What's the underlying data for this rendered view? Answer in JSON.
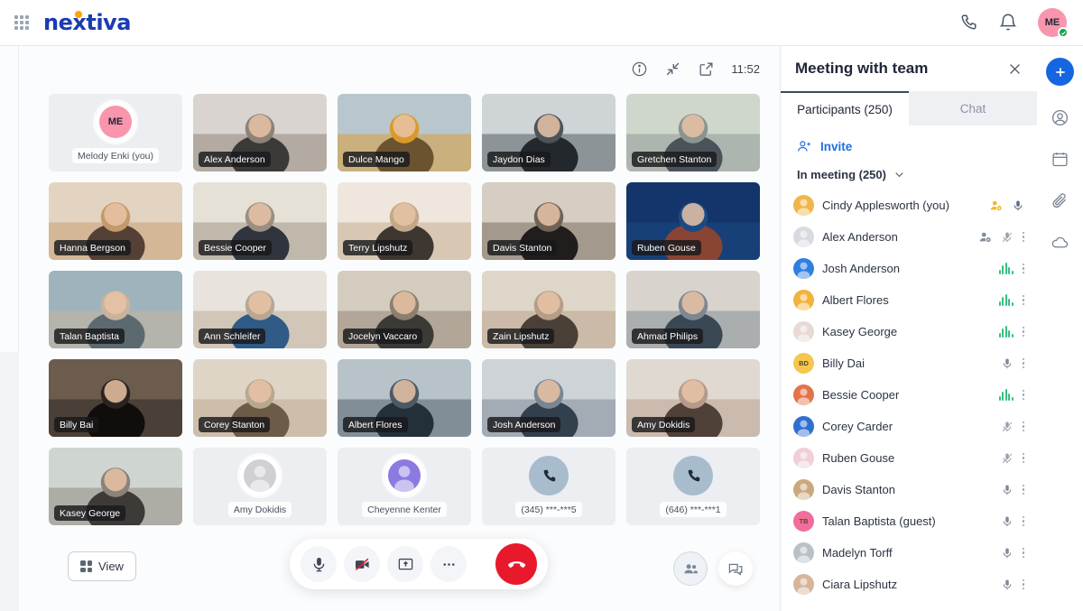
{
  "brand": {
    "name": "nextiva"
  },
  "topbar": {
    "phone_icon": "phone-icon",
    "bell_icon": "bell-icon",
    "avatar_initials": "ME"
  },
  "stage": {
    "time": "11:52",
    "info_icon": "info-icon",
    "collapse_icon": "collapse-icon",
    "popout_icon": "popout-icon",
    "view_button": "View",
    "controls": {
      "mic": "microphone",
      "camera": "camera-off",
      "share": "share-screen",
      "more": "more-options",
      "hangup": "end-call"
    },
    "right_controls": {
      "participants": "participants-toggle",
      "chat": "chat-toggle"
    }
  },
  "video_grid": {
    "rows": [
      [
        {
          "name": "Melody Enki (you)",
          "type": "self-novideo",
          "initials": "ME",
          "avatar_bg": "#f995ad"
        },
        {
          "name": "Alex Anderson",
          "type": "video",
          "c1": "#d9d4cf",
          "c2": "#8e8276",
          "c3": "#3c3a38"
        },
        {
          "name": "Dulce Mango",
          "type": "video",
          "c1": "#b9c6cd",
          "c2": "#d99a2b",
          "c3": "#6b5230"
        },
        {
          "name": "Jaydon Dias",
          "type": "video",
          "c1": "#cfd4d6",
          "c2": "#4c5359",
          "c3": "#23282c"
        },
        {
          "name": "Gretchen Stanton",
          "type": "video",
          "c1": "#cfd7cc",
          "c2": "#8a9490",
          "c3": "#4a5359"
        }
      ],
      [
        {
          "name": "Hanna Bergson",
          "type": "video",
          "c1": "#e3d4c2",
          "c2": "#c49a6c",
          "c3": "#554035"
        },
        {
          "name": "Bessie Cooper",
          "type": "video",
          "c1": "#e6e1d7",
          "c2": "#9a8f80",
          "c3": "#30343c"
        },
        {
          "name": "Terry Lipshutz",
          "type": "video",
          "c1": "#efe7dd",
          "c2": "#c2a789",
          "c3": "#3e3630"
        },
        {
          "name": "Davis Stanton",
          "type": "video",
          "c1": "#d6cec2",
          "c2": "#6f6356",
          "c3": "#201d1c"
        },
        {
          "name": "Ruben Gouse",
          "type": "video",
          "c1": "#13356b",
          "c2": "#1b4a86",
          "c3": "#8a4434"
        }
      ],
      [
        {
          "name": "Talan Baptista",
          "type": "video",
          "c1": "#9fb3bd",
          "c2": "#c9b39c",
          "c3": "#5c6a70"
        },
        {
          "name": "Ann Schleifer",
          "type": "video",
          "c1": "#e8e4dd",
          "c2": "#b9a794",
          "c3": "#2f5b86"
        },
        {
          "name": "Jocelyn Vaccaro",
          "type": "video",
          "c1": "#d5ccc0",
          "c2": "#8d7f6d",
          "c3": "#3b3a36"
        },
        {
          "name": "Zain Lipshutz",
          "type": "video",
          "c1": "#ded6c8",
          "c2": "#b59d86",
          "c3": "#4a4038"
        },
        {
          "name": "Ahmad Philips",
          "type": "video",
          "c1": "#d8d4cd",
          "c2": "#7e8892",
          "c3": "#3a4856"
        }
      ],
      [
        {
          "name": "Billy Bai",
          "type": "video",
          "c1": "#6c5c4e",
          "c2": "#2a2320",
          "c3": "#100d0c"
        },
        {
          "name": "Corey Stanton",
          "type": "video",
          "c1": "#ded5c7",
          "c2": "#b9a88f",
          "c3": "#6b5b47"
        },
        {
          "name": "Albert Flores",
          "type": "video",
          "c1": "#b8c3c9",
          "c2": "#4c5a66",
          "c3": "#23303a"
        },
        {
          "name": "Josh Anderson",
          "type": "video",
          "c1": "#cdd3d6",
          "c2": "#7a8693",
          "c3": "#32404e"
        },
        {
          "name": "Amy Dokidis",
          "type": "video",
          "c1": "#e0d9d1",
          "c2": "#b59b8c",
          "c3": "#4f4038"
        }
      ],
      [
        {
          "name": "Kasey George",
          "type": "video",
          "c1": "#cfd6d2",
          "c2": "#8c8277",
          "c3": "#3d3a37"
        },
        {
          "name": "Amy Dokidis",
          "type": "novideo",
          "avatar_bg": "#cfcfd4"
        },
        {
          "name": "Cheyenne Kenter",
          "type": "novideo",
          "avatar_bg": "#8d7ae0"
        },
        {
          "name": "(345) ***-***5",
          "type": "phone"
        },
        {
          "name": "(646) ***-***1",
          "type": "phone"
        }
      ]
    ]
  },
  "panel": {
    "title": "Meeting with team",
    "close_icon": "close-icon",
    "tabs": [
      {
        "label": "Participants (250)",
        "active": true
      },
      {
        "label": "Chat",
        "active": false
      }
    ],
    "invite_label": "Invite",
    "section_label": "In meeting (250)",
    "participants": [
      {
        "name": "Cindy Applesworth (you)",
        "avatar_bg": "#f0b64a",
        "initials": "",
        "photo": true,
        "icons": [
          "host",
          "mic-blue"
        ]
      },
      {
        "name": "Alex Anderson",
        "avatar_bg": "#d8dae0",
        "photo": true,
        "icons": [
          "cohost",
          "muted",
          "kebab"
        ]
      },
      {
        "name": "Josh Anderson",
        "avatar_bg": "#2f7fe0",
        "photo": true,
        "icons": [
          "wave",
          "kebab"
        ]
      },
      {
        "name": "Albert Flores",
        "avatar_bg": "#f2b33d",
        "photo": true,
        "icons": [
          "wave",
          "kebab"
        ]
      },
      {
        "name": "Kasey George",
        "avatar_bg": "#e7d9d3",
        "photo": true,
        "icons": [
          "wave",
          "kebab"
        ]
      },
      {
        "name": "Billy Dai",
        "avatar_bg": "#f6c64f",
        "initials": "BD",
        "photo": false,
        "icons": [
          "mic",
          "kebab"
        ]
      },
      {
        "name": "Bessie Cooper",
        "avatar_bg": "#e2734a",
        "photo": true,
        "icons": [
          "wave",
          "kebab"
        ]
      },
      {
        "name": "Corey Carder",
        "avatar_bg": "#2f6fd0",
        "photo": true,
        "icons": [
          "muted",
          "kebab"
        ]
      },
      {
        "name": "Ruben Gouse",
        "avatar_bg": "#f0cfd6",
        "photo": true,
        "icons": [
          "muted",
          "kebab"
        ]
      },
      {
        "name": "Davis Stanton",
        "avatar_bg": "#c9a87c",
        "photo": true,
        "icons": [
          "mic",
          "kebab"
        ]
      },
      {
        "name": "Talan Baptista (guest)",
        "avatar_bg": "#f26d9b",
        "initials": "TB",
        "photo": false,
        "icons": [
          "mic",
          "kebab"
        ]
      },
      {
        "name": "Madelyn Torff",
        "avatar_bg": "#b9c1c6",
        "photo": true,
        "icons": [
          "mic",
          "kebab"
        ]
      },
      {
        "name": "Ciara Lipshutz",
        "avatar_bg": "#d7b49a",
        "photo": true,
        "icons": [
          "mic",
          "kebab"
        ]
      }
    ]
  },
  "iconrail": {
    "plus": "add-button",
    "items": [
      "contacts-icon",
      "calendar-icon",
      "attachment-icon",
      "cloud-icon"
    ]
  }
}
